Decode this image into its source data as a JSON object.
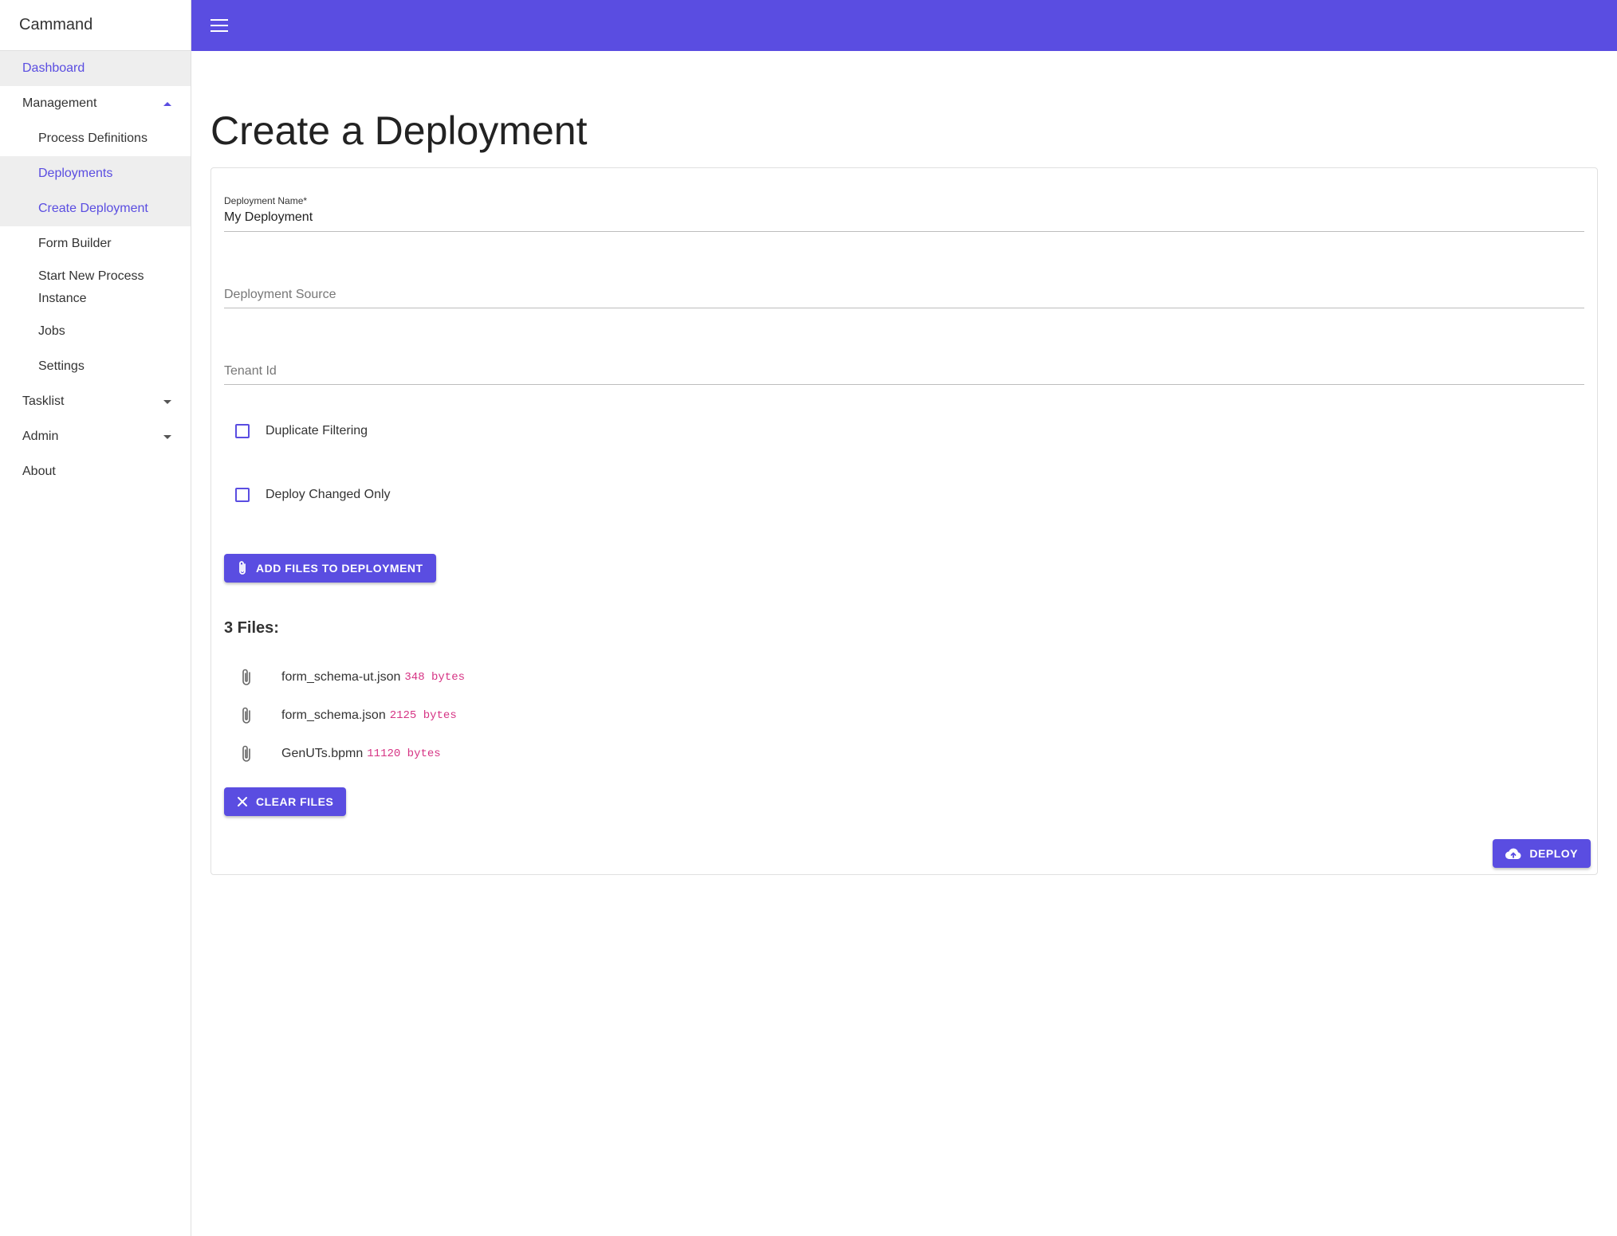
{
  "app": {
    "title": "Cammand"
  },
  "sidebar": {
    "dashboard": "Dashboard",
    "management": {
      "label": "Management",
      "items": [
        {
          "label": "Process Definitions"
        },
        {
          "label": "Deployments"
        },
        {
          "label": "Create Deployment"
        },
        {
          "label": "Form Builder"
        },
        {
          "label": "Start New Process Instance"
        },
        {
          "label": "Jobs"
        },
        {
          "label": "Settings"
        }
      ]
    },
    "tasklist": "Tasklist",
    "admin": "Admin",
    "about": "About"
  },
  "header": {
    "menu_icon": "menu-icon"
  },
  "page": {
    "title": "Create a Deployment"
  },
  "form": {
    "deployment_name": {
      "label": "Deployment Name*",
      "value": "My Deployment"
    },
    "deployment_source": {
      "placeholder": "Deployment Source"
    },
    "tenant_id": {
      "placeholder": "Tenant Id"
    },
    "duplicate_filtering": {
      "label": "Duplicate Filtering",
      "checked": false
    },
    "deploy_changed_only": {
      "label": "Deploy Changed Only",
      "checked": false
    },
    "add_files_button": "ADD FILES TO DEPLOYMENT",
    "files_title": "3 Files:",
    "files": [
      {
        "name": "form_schema-ut.json",
        "size": "348 bytes"
      },
      {
        "name": "form_schema.json",
        "size": "2125 bytes"
      },
      {
        "name": "GenUTs.bpmn",
        "size": "11120 bytes"
      }
    ],
    "clear_files_button": "CLEAR FILES",
    "deploy_button": "DEPLOY"
  },
  "colors": {
    "accent": "#5a4de1",
    "file_size": "#d63384"
  }
}
